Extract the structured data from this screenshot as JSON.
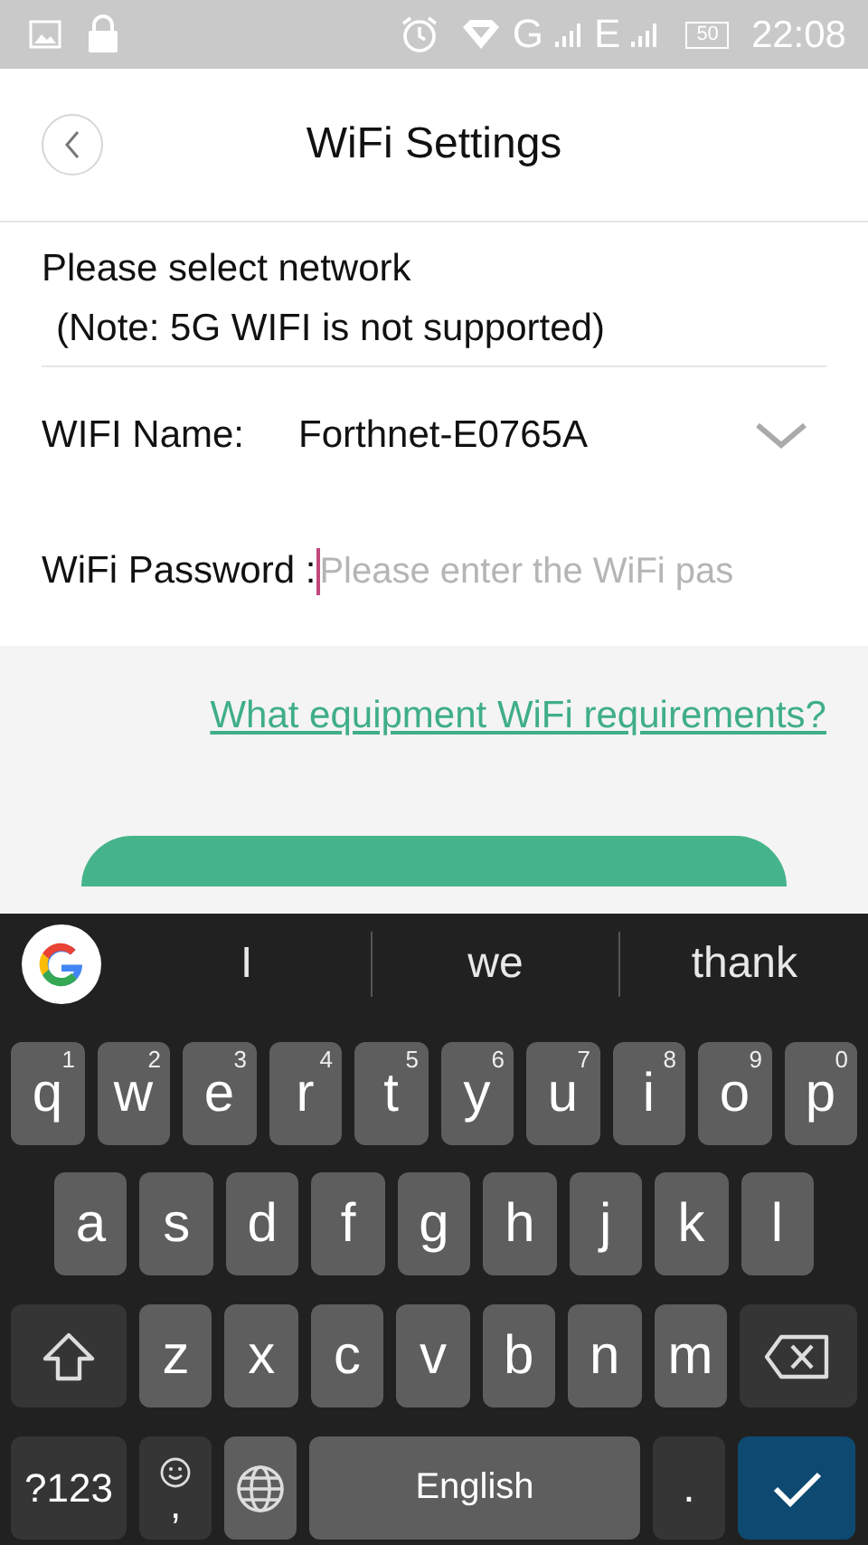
{
  "status_bar": {
    "network_1": "G",
    "network_2": "E",
    "battery": "50",
    "time": "22:08"
  },
  "header": {
    "title": "WiFi Settings"
  },
  "form": {
    "heading": "Please select network",
    "note": "(Note: 5G WIFI is not supported)",
    "wifi_name": {
      "label": "WIFI Name:",
      "value": "Forthnet-E0765A"
    },
    "password": {
      "label": "WiFi Password :",
      "placeholder": "Please enter the WiFi pas",
      "focused": true
    }
  },
  "help_link": "What equipment WiFi requirements?",
  "keyboard": {
    "suggestions": [
      "I",
      "we",
      "thank"
    ],
    "key_rows": [
      {
        "keys": [
          {
            "kind": "letter",
            "label": "q",
            "hint": "1"
          },
          {
            "kind": "letter",
            "label": "w",
            "hint": "2"
          },
          {
            "kind": "letter",
            "label": "e",
            "hint": "3"
          },
          {
            "kind": "letter",
            "label": "r",
            "hint": "4"
          },
          {
            "kind": "letter",
            "label": "t",
            "hint": "5"
          },
          {
            "kind": "letter",
            "label": "y",
            "hint": "6"
          },
          {
            "kind": "letter",
            "label": "u",
            "hint": "7"
          },
          {
            "kind": "letter",
            "label": "i",
            "hint": "8"
          },
          {
            "kind": "letter",
            "label": "o",
            "hint": "9"
          },
          {
            "kind": "letter",
            "label": "p",
            "hint": "0"
          }
        ]
      },
      {
        "keys": [
          {
            "kind": "letter",
            "label": "a"
          },
          {
            "kind": "letter",
            "label": "s"
          },
          {
            "kind": "letter",
            "label": "d"
          },
          {
            "kind": "letter",
            "label": "f"
          },
          {
            "kind": "letter",
            "label": "g"
          },
          {
            "kind": "letter",
            "label": "h"
          },
          {
            "kind": "letter",
            "label": "j"
          },
          {
            "kind": "letter",
            "label": "k"
          },
          {
            "kind": "letter",
            "label": "l"
          }
        ]
      },
      {
        "keys": [
          {
            "kind": "shift"
          },
          {
            "kind": "letter",
            "label": "z"
          },
          {
            "kind": "letter",
            "label": "x"
          },
          {
            "kind": "letter",
            "label": "c"
          },
          {
            "kind": "letter",
            "label": "v"
          },
          {
            "kind": "letter",
            "label": "b"
          },
          {
            "kind": "letter",
            "label": "n"
          },
          {
            "kind": "letter",
            "label": "m"
          },
          {
            "kind": "backspace"
          }
        ]
      },
      {
        "keys": [
          {
            "kind": "symbols",
            "label": "?123"
          },
          {
            "kind": "emoji",
            "label": ","
          },
          {
            "kind": "globe"
          },
          {
            "kind": "space",
            "label": "English"
          },
          {
            "kind": "period",
            "label": "."
          },
          {
            "kind": "enter"
          }
        ]
      }
    ]
  }
}
